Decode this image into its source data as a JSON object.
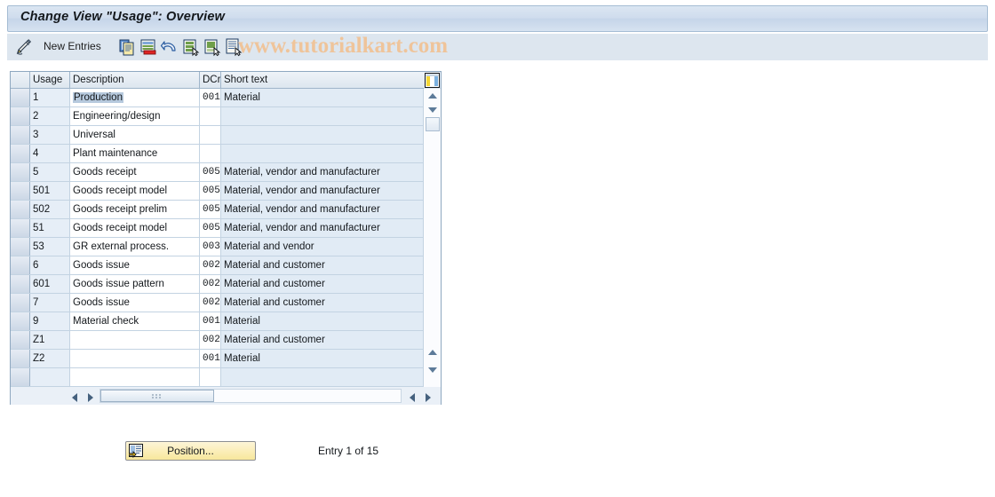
{
  "window": {
    "title": "Change View \"Usage\": Overview"
  },
  "toolbar": {
    "edit_icon": "pencil-icon",
    "new_entries_label": "New Entries",
    "buttons": [
      {
        "name": "copy-as-icon",
        "title": "Copy As..."
      },
      {
        "name": "delete-icon",
        "title": "Delete"
      },
      {
        "name": "undo-icon",
        "title": "Undo Change"
      },
      {
        "name": "select-all-icon",
        "title": "Select All"
      },
      {
        "name": "deselect-all-icon",
        "title": "Deselect All"
      },
      {
        "name": "details-icon",
        "title": "Details"
      }
    ],
    "watermark": "www.tutorialkart.com",
    "watermark_color": "#efc49a"
  },
  "table": {
    "columns": [
      {
        "key": "sel",
        "label": ""
      },
      {
        "key": "usage",
        "label": "Usage"
      },
      {
        "key": "desc",
        "label": "Description"
      },
      {
        "key": "dcr",
        "label": "DCr"
      },
      {
        "key": "short",
        "label": "Short text"
      }
    ],
    "column_config_icon": "table-settings-icon",
    "selected_row_index": 0,
    "selected_cell_column": "desc",
    "rows": [
      {
        "usage": "1",
        "desc": "Production",
        "dcr": "001",
        "short": "Material"
      },
      {
        "usage": "2",
        "desc": "Engineering/design",
        "dcr": "",
        "short": ""
      },
      {
        "usage": "3",
        "desc": "Universal",
        "dcr": "",
        "short": ""
      },
      {
        "usage": "4",
        "desc": "Plant maintenance",
        "dcr": "",
        "short": ""
      },
      {
        "usage": "5",
        "desc": "Goods receipt",
        "dcr": "005",
        "short": "Material, vendor and manufacturer"
      },
      {
        "usage": "501",
        "desc": "Goods receipt model",
        "dcr": "005",
        "short": "Material, vendor and manufacturer"
      },
      {
        "usage": "502",
        "desc": "Goods receipt prelim",
        "dcr": "005",
        "short": "Material, vendor and manufacturer"
      },
      {
        "usage": "51",
        "desc": "Goods receipt model",
        "dcr": "005",
        "short": "Material, vendor and manufacturer"
      },
      {
        "usage": "53",
        "desc": "GR external process.",
        "dcr": "003",
        "short": "Material and vendor"
      },
      {
        "usage": "6",
        "desc": "Goods issue",
        "dcr": "002",
        "short": "Material and customer"
      },
      {
        "usage": "601",
        "desc": "Goods issue pattern",
        "dcr": "002",
        "short": "Material and customer"
      },
      {
        "usage": "7",
        "desc": "Goods issue",
        "dcr": "002",
        "short": "Material and customer"
      },
      {
        "usage": "9",
        "desc": "Material check",
        "dcr": "001",
        "short": "Material"
      },
      {
        "usage": "Z1",
        "desc": "",
        "dcr": "002",
        "short": "Material and customer"
      },
      {
        "usage": "Z2",
        "desc": "",
        "dcr": "001",
        "short": "Material"
      },
      {
        "usage": "",
        "desc": "",
        "dcr": "",
        "short": ""
      }
    ]
  },
  "footer": {
    "position_button_label": "Position...",
    "position_button_icon": "position-icon",
    "entry_status": "Entry 1 of 15"
  }
}
